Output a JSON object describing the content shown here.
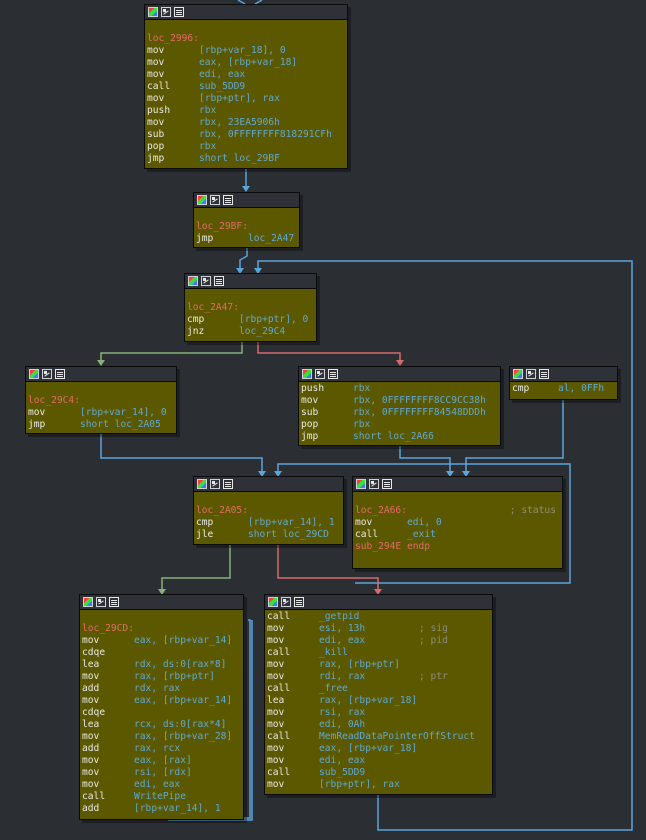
{
  "colors": {
    "node_bg": "#5c5800",
    "edge_blue": "#5aa6dc",
    "edge_green": "#88b07c",
    "edge_red": "#d86a6a",
    "label": "#e36a6a",
    "operand": "#5fa8d3",
    "comment": "#8d8d7a"
  },
  "nodes": {
    "n2996": {
      "lines": [
        {
          "t": "blank"
        },
        {
          "t": "label",
          "text": "loc_2996:"
        },
        {
          "m": "mov",
          "o": "[rbp+var_18], 0"
        },
        {
          "m": "mov",
          "o": "eax, [rbp+var_18]"
        },
        {
          "m": "mov",
          "o": "edi, eax"
        },
        {
          "m": "call",
          "o": "sub_5DD9"
        },
        {
          "m": "mov",
          "o": "[rbp+ptr], rax"
        },
        {
          "m": "push",
          "o": "rbx"
        },
        {
          "m": "mov",
          "o": "rbx, 23EA5906h"
        },
        {
          "m": "sub",
          "o": "rbx, 0FFFFFFFF818291CFh"
        },
        {
          "m": "pop",
          "o": "rbx"
        },
        {
          "m": "jmp",
          "o": "short loc_29BF"
        }
      ]
    },
    "n29bf": {
      "lines": [
        {
          "t": "blank"
        },
        {
          "t": "label",
          "text": "loc_29BF:"
        },
        {
          "m": "jmp",
          "o": "loc_2A47"
        }
      ]
    },
    "n2a47": {
      "lines": [
        {
          "t": "blank"
        },
        {
          "t": "label",
          "text": "loc_2A47:"
        },
        {
          "m": "cmp",
          "o": "[rbp+ptr], 0"
        },
        {
          "m": "jnz",
          "o": "loc_29C4"
        }
      ]
    },
    "n29c4": {
      "lines": [
        {
          "t": "blank"
        },
        {
          "t": "label",
          "text": "loc_29C4:"
        },
        {
          "m": "mov",
          "o": "[rbp+var_14], 0"
        },
        {
          "m": "jmp",
          "o": "short loc_2A05"
        }
      ]
    },
    "npush": {
      "lines": [
        {
          "m": "push",
          "o": "rbx"
        },
        {
          "m": "mov",
          "o": "rbx, 0FFFFFFFF8CC9CC38h"
        },
        {
          "m": "sub",
          "o": "rbx, 0FFFFFFFF84548DDDh"
        },
        {
          "m": "pop",
          "o": "rbx"
        },
        {
          "m": "jmp",
          "o": "short loc_2A66"
        }
      ]
    },
    "ncmpal": {
      "lines": [
        {
          "m": "cmp",
          "o": "al, 0FFh"
        }
      ]
    },
    "n2a05": {
      "lines": [
        {
          "t": "blank"
        },
        {
          "t": "label",
          "text": "loc_2A05:"
        },
        {
          "m": "cmp",
          "o": "[rbp+var_14], 1"
        },
        {
          "m": "jle",
          "o": "short loc_29CD"
        }
      ]
    },
    "n2a66": {
      "lines": [
        {
          "t": "blank"
        },
        {
          "t": "label",
          "text": "loc_2A66:",
          "c": "; status"
        },
        {
          "m": "mov",
          "o": "edi, 0"
        },
        {
          "m": "call",
          "o": "_exit"
        },
        {
          "t": "label",
          "text": "sub_294E endp"
        }
      ]
    },
    "n29cd": {
      "lines": [
        {
          "t": "blank"
        },
        {
          "t": "label",
          "text": "loc_29CD:"
        },
        {
          "m": "mov",
          "o": "eax, [rbp+var_14]"
        },
        {
          "m": "cdqe",
          "o": ""
        },
        {
          "m": "lea",
          "o": "rdx, ds:0[rax*8]"
        },
        {
          "m": "mov",
          "o": "rax, [rbp+ptr]"
        },
        {
          "m": "add",
          "o": "rdx, rax"
        },
        {
          "m": "mov",
          "o": "eax, [rbp+var_14]"
        },
        {
          "m": "cdqe",
          "o": ""
        },
        {
          "m": "lea",
          "o": "rcx, ds:0[rax*4]"
        },
        {
          "m": "mov",
          "o": "rax, [rbp+var_28]"
        },
        {
          "m": "add",
          "o": "rax, rcx"
        },
        {
          "m": "mov",
          "o": "eax, [rax]"
        },
        {
          "m": "mov",
          "o": "rsi, [rdx]"
        },
        {
          "m": "mov",
          "o": "edi, eax"
        },
        {
          "m": "call",
          "o": "WritePipe"
        },
        {
          "m": "add",
          "o": "[rbp+var_14], 1"
        }
      ]
    },
    "ngetpid": {
      "lines": [
        {
          "m": "call",
          "o": "_getpid"
        },
        {
          "m": "mov",
          "o": "esi, 13h",
          "c": "; sig"
        },
        {
          "m": "mov",
          "o": "edi, eax",
          "c": "; pid"
        },
        {
          "m": "call",
          "o": "_kill"
        },
        {
          "m": "mov",
          "o": "rax, [rbp+ptr]"
        },
        {
          "m": "mov",
          "o": "rdi, rax",
          "c": "; ptr"
        },
        {
          "m": "call",
          "o": "_free"
        },
        {
          "m": "lea",
          "o": "rax, [rbp+var_18]"
        },
        {
          "m": "mov",
          "o": "rsi, rax"
        },
        {
          "m": "mov",
          "o": "edi, 0Ah"
        },
        {
          "m": "call",
          "o": "MemReadDataPointerOffStruct"
        },
        {
          "m": "mov",
          "o": "eax, [rbp+var_18]"
        },
        {
          "m": "mov",
          "o": "edi, eax"
        },
        {
          "m": "call",
          "o": "sub_5DD9"
        },
        {
          "m": "mov",
          "o": "[rbp+ptr], rax"
        }
      ]
    }
  }
}
